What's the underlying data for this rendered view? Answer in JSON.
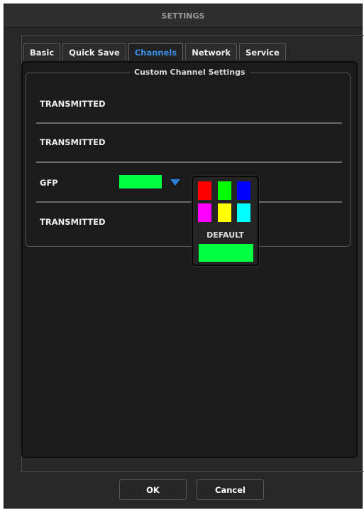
{
  "window": {
    "title": "SETTINGS"
  },
  "tabs": [
    {
      "label": "Basic",
      "active": false
    },
    {
      "label": "Quick Save",
      "active": false
    },
    {
      "label": "Channels",
      "active": true
    },
    {
      "label": "Network",
      "active": false
    },
    {
      "label": "Service",
      "active": false
    }
  ],
  "custom_channel_settings": {
    "legend": "Custom Channel Settings",
    "channels": [
      {
        "label": "TRANSMITTED"
      },
      {
        "label": "TRANSMITTED"
      },
      {
        "label": "GFP",
        "color": "#00ff40"
      },
      {
        "label": "TRANSMITTED"
      }
    ]
  },
  "color_picker": {
    "swatches": [
      {
        "name": "red",
        "color": "#ff0000"
      },
      {
        "name": "green",
        "color": "#00ff00"
      },
      {
        "name": "blue",
        "color": "#0000ff"
      },
      {
        "name": "magenta",
        "color": "#ff00ff"
      },
      {
        "name": "yellow",
        "color": "#ffff00"
      },
      {
        "name": "cyan",
        "color": "#00ffff"
      }
    ],
    "default_label": "DEFAULT",
    "default_color": "#00ff40"
  },
  "buttons": {
    "ok": "OK",
    "cancel": "Cancel"
  }
}
